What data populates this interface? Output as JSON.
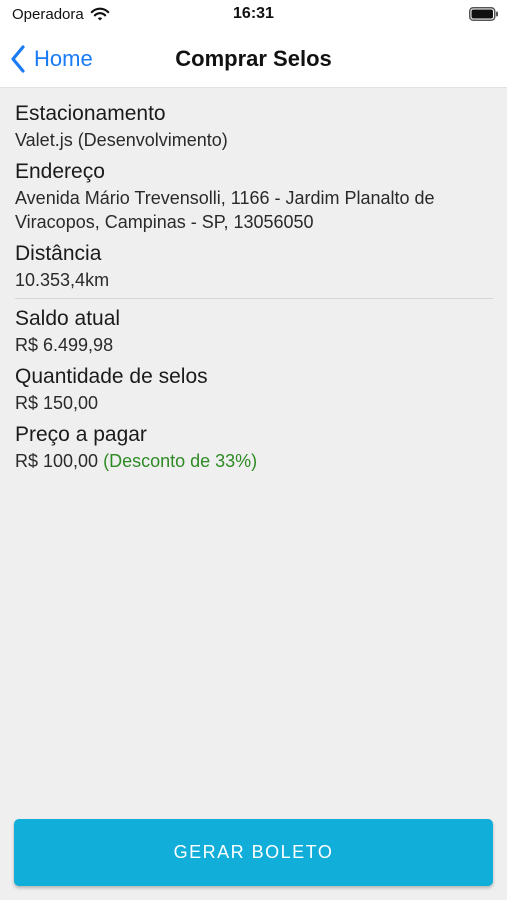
{
  "status_bar": {
    "carrier": "Operadora",
    "time": "16:31",
    "icons": [
      "wifi-icon",
      "battery-icon"
    ]
  },
  "nav": {
    "back_label": "Home",
    "title": "Comprar Selos",
    "back_icon": "chevron-left-icon",
    "accent_color": "#1a7cf5"
  },
  "parking": {
    "label": "Estacionamento",
    "value": "Valet.js (Desenvolvimento)"
  },
  "address": {
    "label": "Endereço",
    "line1": "Avenida Mário Trevensolli, 1166 - Jardim Planalto de",
    "line2": "Viracopos, Campinas - SP, 13056050"
  },
  "distance": {
    "label": "Distância",
    "value": "10.353,4km"
  },
  "balance": {
    "label": "Saldo atual",
    "value": "R$ 6.499,98"
  },
  "stamps": {
    "label": "Quantidade de selos",
    "value": "R$ 150,00"
  },
  "price": {
    "label": "Preço a pagar",
    "value": "R$ 100,00",
    "discount": "(Desconto de 33%)",
    "discount_color": "#2e8b24"
  },
  "action": {
    "label": "GERAR BOLETO",
    "color": "#10aed9"
  }
}
